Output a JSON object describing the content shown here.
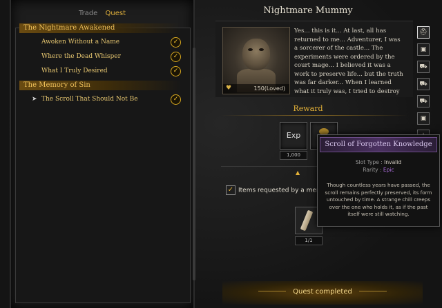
{
  "tabs": [
    {
      "label": "Trade",
      "active": false
    },
    {
      "label": "Quest",
      "active": true
    }
  ],
  "quest_groups": [
    {
      "title": "The Nightmare Awakened",
      "quests": [
        {
          "label": "Awoken Without a Name",
          "completed": true
        },
        {
          "label": "Where the Dead Whisper",
          "completed": true
        },
        {
          "label": "What I Truly Desired",
          "completed": true
        }
      ]
    },
    {
      "title": "The Memory of Sin",
      "quests": [
        {
          "label": "The Scroll That Should Not Be",
          "completed": true,
          "selected": true
        }
      ]
    }
  ],
  "npc": {
    "name": "Nightmare Mummy",
    "affinity": "150(Loved)",
    "dialog": "Yes... this is it... At last, all has returned to me... Adventurer, I was a sorcerer of the castle... The experiments were ordered by the court mage... I believed it was a work to preserve life... but the truth was far darker... When I learned what it truly was, I tried to destroy the scroll... but I"
  },
  "reward": {
    "title": "Reward",
    "exp_label": "Exp",
    "exp_amount": "1,000"
  },
  "requested": {
    "label": "Items requested by a mer",
    "item_count": "1/1"
  },
  "complete_button": "Quest completed",
  "tooltip": {
    "title": "Scroll of Forgotten Knowledge",
    "slot_type_label": "Slot Type :",
    "slot_type_value": "Invalid",
    "rarity_label": "Rarity :",
    "rarity_value": "Epic",
    "description": "Though countless years have passed, the scroll remains perfectly preserved, its form untouched by time. A strange chill creeps over the one who holds it, as if the past itself were still watching."
  },
  "side_icons": [
    "helmet-icon",
    "chest-icon",
    "cart-icon",
    "cart-icon",
    "cart-icon",
    "chest-icon",
    "star-icon"
  ],
  "colors": {
    "accent_gold": "#e5b238",
    "epic_purple": "#b06fe0"
  }
}
